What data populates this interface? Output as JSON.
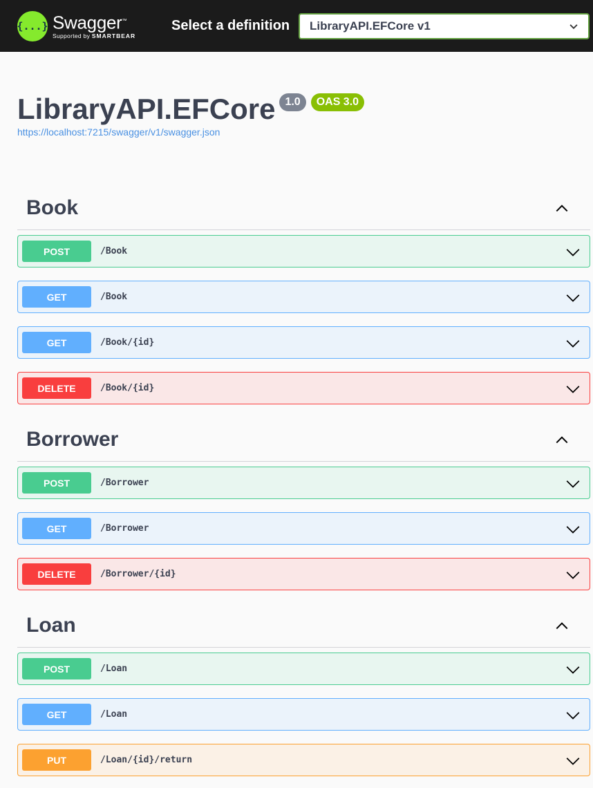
{
  "topbar": {
    "logo_symbol": "{...}",
    "logo_name": "Swagger",
    "logo_tm": "™",
    "logo_supported": "Supported by",
    "logo_brand": "SMARTBEAR",
    "definition_label": "Select a definition",
    "definition_selected": "LibraryAPI.EFCore v1"
  },
  "info": {
    "title": "LibraryAPI.EFCore",
    "version": "1.0",
    "oas": "OAS 3.0",
    "spec_url": "https://localhost:7215/swagger/v1/swagger.json"
  },
  "colors": {
    "post": "#49cc90",
    "get": "#61affe",
    "delete": "#f93e3e",
    "put": "#fca130",
    "topbar": "#1b1b1b",
    "logo": "#85ea2d"
  },
  "tags": [
    {
      "name": "Book",
      "operations": [
        {
          "method": "POST",
          "path": "/Book"
        },
        {
          "method": "GET",
          "path": "/Book"
        },
        {
          "method": "GET",
          "path": "/Book/{id}"
        },
        {
          "method": "DELETE",
          "path": "/Book/{id}"
        }
      ]
    },
    {
      "name": "Borrower",
      "operations": [
        {
          "method": "POST",
          "path": "/Borrower"
        },
        {
          "method": "GET",
          "path": "/Borrower"
        },
        {
          "method": "DELETE",
          "path": "/Borrower/{id}"
        }
      ]
    },
    {
      "name": "Loan",
      "operations": [
        {
          "method": "POST",
          "path": "/Loan"
        },
        {
          "method": "GET",
          "path": "/Loan"
        },
        {
          "method": "PUT",
          "path": "/Loan/{id}/return"
        }
      ]
    }
  ]
}
